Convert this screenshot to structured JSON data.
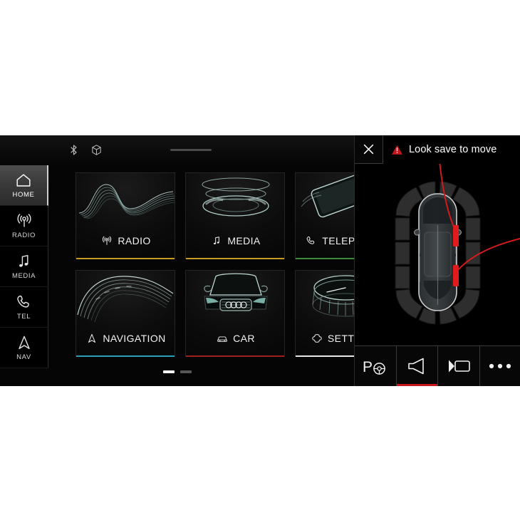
{
  "statusbar": {
    "icons": [
      {
        "name": "bluetooth-icon",
        "label": "Bluetooth"
      },
      {
        "name": "cube-3d-icon",
        "label": "3D View"
      }
    ],
    "drag_handle": "drag-handle"
  },
  "sidebar": {
    "items": [
      {
        "label": "HOME",
        "icon": "home-icon",
        "active": true
      },
      {
        "label": "RADIO",
        "icon": "radio-icon",
        "active": false
      },
      {
        "label": "MEDIA",
        "icon": "media-icon",
        "active": false
      },
      {
        "label": "TEL",
        "icon": "phone-icon",
        "active": false
      },
      {
        "label": "NAV",
        "icon": "nav-arrow-icon",
        "active": false
      }
    ]
  },
  "tiles": {
    "row1": [
      {
        "label": "RADIO",
        "icon": "radio-icon",
        "accent": "#c89a20",
        "art": "waveform"
      },
      {
        "label": "MEDIA",
        "icon": "note-icon",
        "accent": "#c89a20",
        "art": "speaker-rings"
      },
      {
        "label": "TELEPHONE",
        "icon": "phone-icon",
        "accent": "#3f8b3f",
        "art": "smartphone"
      }
    ],
    "row2": [
      {
        "label": "NAVIGATION",
        "icon": "nav-arrow-icon",
        "accent": "#2aa0b4",
        "art": "road-curve"
      },
      {
        "label": "CAR",
        "icon": "car-icon",
        "accent": "#9e2020",
        "art": "car-front"
      },
      {
        "label": "SETTINGS",
        "icon": "gear-icon",
        "accent": "#e8e8e8",
        "art": "rotary-knob"
      }
    ]
  },
  "pager": {
    "pages": 2,
    "active_page": 1
  },
  "panel": {
    "close_label": "Close",
    "warning_text": "Look save to move",
    "warning_color": "#c4161c",
    "view": {
      "name": "top-down-parking-sensor-view",
      "alerts": [
        {
          "position": "front-right-door",
          "color": "#e01b1b"
        },
        {
          "position": "rear-right-door",
          "color": "#e01b1b"
        }
      ]
    },
    "toolbar": [
      {
        "label": "Park Assist",
        "icon": "park-assist-icon",
        "active": false
      },
      {
        "label": "Audio Alerts",
        "icon": "speaker-icon",
        "active": true
      },
      {
        "label": "Camera View",
        "icon": "camera-view-icon",
        "active": false
      },
      {
        "label": "More Options",
        "icon": "more-dots-icon",
        "active": false
      }
    ]
  }
}
